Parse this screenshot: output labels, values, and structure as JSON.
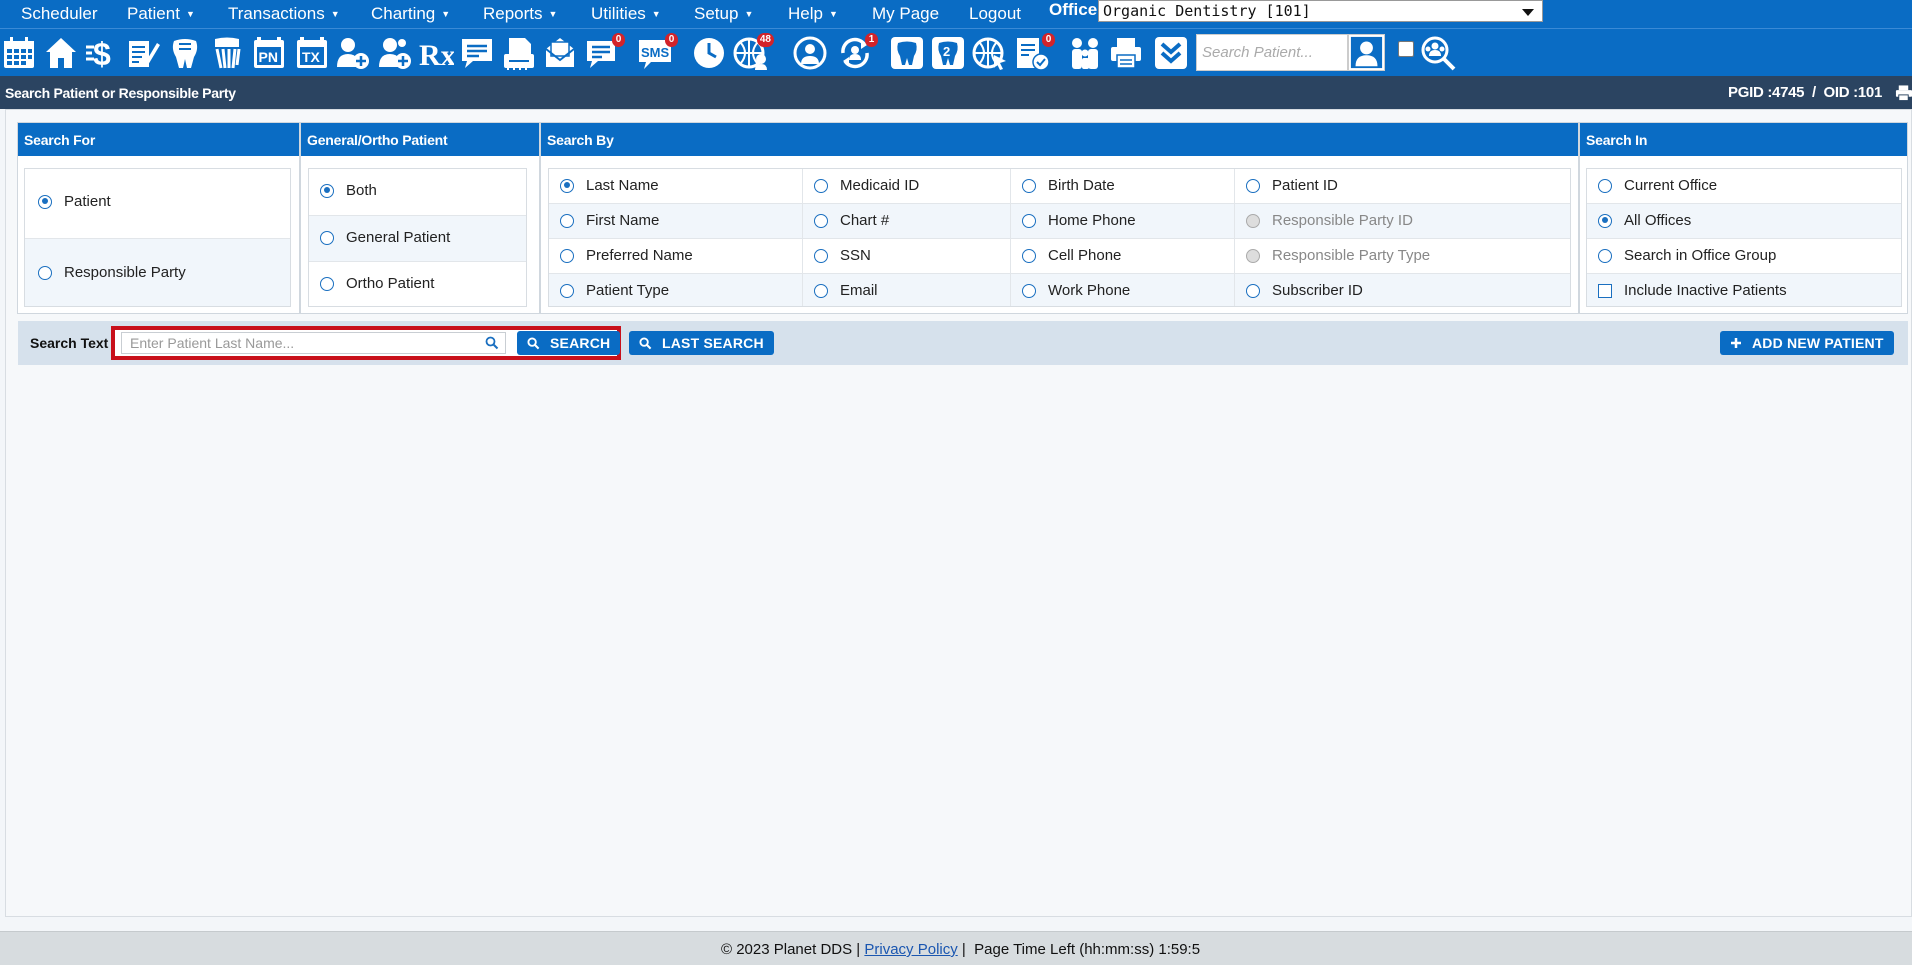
{
  "menu": {
    "items": [
      {
        "label": "Scheduler",
        "caret": false
      },
      {
        "label": "Patient",
        "caret": true
      },
      {
        "label": "Transactions",
        "caret": true
      },
      {
        "label": "Charting",
        "caret": true
      },
      {
        "label": "Reports",
        "caret": true
      },
      {
        "label": "Utilities",
        "caret": true
      },
      {
        "label": "Setup",
        "caret": true
      },
      {
        "label": "Help",
        "caret": true
      },
      {
        "label": "My Page",
        "caret": false
      },
      {
        "label": "Logout",
        "caret": false
      }
    ],
    "office_label": "Office",
    "office_value": "Organic Dentistry [101]"
  },
  "toolbar": {
    "pn": "PN",
    "tx": "TX",
    "rx": "Rx",
    "sms": "SMS",
    "badge_chat": "0",
    "badge_sms": "0",
    "badge_web": "48",
    "badge_sync": "1",
    "badge_doc": "0",
    "tooth_2": "2",
    "search_placeholder": "Search Patient..."
  },
  "titlebar": {
    "title": "Search Patient or Responsible Party",
    "ids": "PGID :4745  /  OID :101"
  },
  "search_for": {
    "header": "Search For",
    "options": [
      "Patient",
      "Responsible Party"
    ],
    "selected": "Patient"
  },
  "general_ortho": {
    "header": "General/Ortho Patient",
    "options": [
      "Both",
      "General Patient",
      "Ortho Patient"
    ],
    "selected": "Both"
  },
  "search_by": {
    "header": "Search By",
    "options": [
      [
        "Last Name",
        "Medicaid ID",
        "Birth Date",
        "Patient ID"
      ],
      [
        "First Name",
        "Chart #",
        "Home Phone",
        "Responsible Party ID"
      ],
      [
        "Preferred Name",
        "SSN",
        "Cell Phone",
        "Responsible Party Type"
      ],
      [
        "Patient Type",
        "Email",
        "Work Phone",
        "Subscriber ID"
      ]
    ],
    "selected": "Last Name",
    "disabled": [
      "Responsible Party ID",
      "Responsible Party Type"
    ]
  },
  "search_in": {
    "header": "Search In",
    "options": [
      "Current Office",
      "All Offices",
      "Search in Office Group"
    ],
    "selected": "All Offices",
    "checkbox_label": "Include Inactive Patients",
    "checkbox_checked": false
  },
  "search_text": {
    "label": "Search Text",
    "placeholder": "Enter Patient Last Name...",
    "value": "",
    "search_button": "SEARCH",
    "last_search_button": "LAST SEARCH",
    "add_new_button": "ADD NEW PATIENT"
  },
  "footer": {
    "copyright": "© 2023 Planet DDS |",
    "privacy": "Privacy Policy",
    "page_time": "|  Page Time Left (hh:mm:ss) 1:59:5"
  },
  "colors": {
    "primary": "#0a6cc4",
    "title_bar": "#2b4461",
    "highlight": "#c8101b",
    "badge": "#d2232a"
  }
}
